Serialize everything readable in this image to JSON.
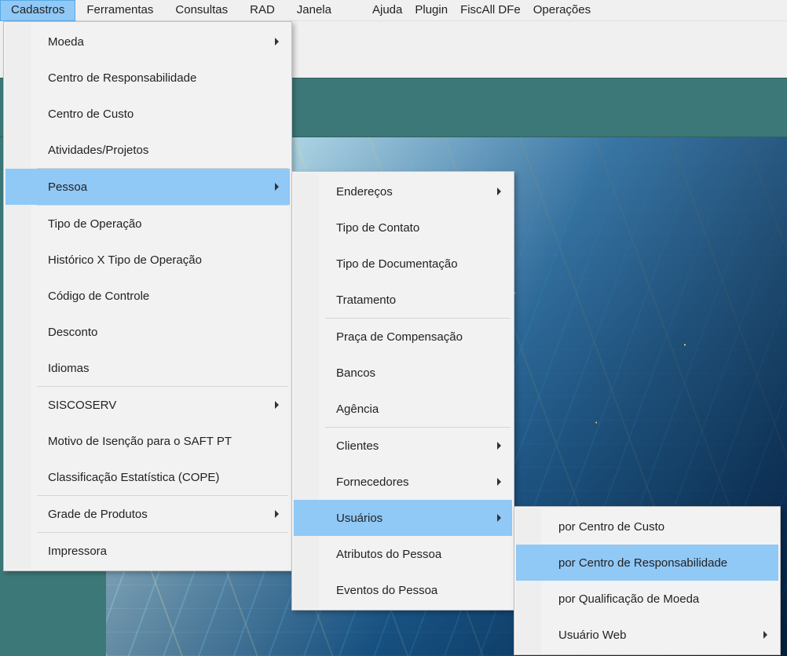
{
  "menubar": {
    "items": [
      {
        "label": "Cadastros",
        "active": true
      },
      {
        "label": "Ferramentas",
        "active": false
      },
      {
        "label": "Consultas",
        "active": false
      },
      {
        "label": "RAD",
        "active": false
      },
      {
        "label": "Janela",
        "active": false
      },
      {
        "label": "Ajuda",
        "active": false
      },
      {
        "label": "Plugin",
        "active": false
      },
      {
        "label": "FiscAll DFe",
        "active": false
      },
      {
        "label": "Operações",
        "active": false
      }
    ]
  },
  "menu_cadastros": {
    "items": [
      {
        "label": "Moeda",
        "submenu": true,
        "sep_after": false,
        "highlight": false
      },
      {
        "label": "Centro de Responsabilidade",
        "submenu": false,
        "sep_after": false,
        "highlight": false
      },
      {
        "label": "Centro de Custo",
        "submenu": false,
        "sep_after": false,
        "highlight": false
      },
      {
        "label": "Atividades/Projetos",
        "submenu": false,
        "sep_after": true,
        "highlight": false
      },
      {
        "label": "Pessoa",
        "submenu": true,
        "sep_after": true,
        "highlight": true
      },
      {
        "label": "Tipo de Operação",
        "submenu": false,
        "sep_after": false,
        "highlight": false
      },
      {
        "label": "Histórico  X Tipo de Operação",
        "submenu": false,
        "sep_after": false,
        "highlight": false
      },
      {
        "label": "Código de Controle",
        "submenu": false,
        "sep_after": false,
        "highlight": false
      },
      {
        "label": "Desconto",
        "submenu": false,
        "sep_after": false,
        "highlight": false
      },
      {
        "label": "Idiomas",
        "submenu": false,
        "sep_after": true,
        "highlight": false
      },
      {
        "label": "SISCOSERV",
        "submenu": true,
        "sep_after": false,
        "highlight": false
      },
      {
        "label": "Motivo de Isenção para o SAFT PT",
        "submenu": false,
        "sep_after": false,
        "highlight": false
      },
      {
        "label": "Classificação Estatística (COPE)",
        "submenu": false,
        "sep_after": true,
        "highlight": false
      },
      {
        "label": "Grade de Produtos",
        "submenu": true,
        "sep_after": true,
        "highlight": false
      },
      {
        "label": "Impressora",
        "submenu": false,
        "sep_after": false,
        "highlight": false
      }
    ]
  },
  "menu_pessoa": {
    "items": [
      {
        "label": "Endereços",
        "submenu": true,
        "sep_after": false,
        "highlight": false
      },
      {
        "label": "Tipo de Contato",
        "submenu": false,
        "sep_after": false,
        "highlight": false
      },
      {
        "label": "Tipo de Documentação",
        "submenu": false,
        "sep_after": false,
        "highlight": false
      },
      {
        "label": "Tratamento",
        "submenu": false,
        "sep_after": true,
        "highlight": false
      },
      {
        "label": "Praça de Compensação",
        "submenu": false,
        "sep_after": false,
        "highlight": false
      },
      {
        "label": "Bancos",
        "submenu": false,
        "sep_after": false,
        "highlight": false
      },
      {
        "label": "Agência",
        "submenu": false,
        "sep_after": true,
        "highlight": false
      },
      {
        "label": "Clientes",
        "submenu": true,
        "sep_after": false,
        "highlight": false
      },
      {
        "label": "Fornecedores",
        "submenu": true,
        "sep_after": false,
        "highlight": false
      },
      {
        "label": "Usuários",
        "submenu": true,
        "sep_after": false,
        "highlight": true
      },
      {
        "label": "Atributos do Pessoa",
        "submenu": false,
        "sep_after": false,
        "highlight": false
      },
      {
        "label": "Eventos do Pessoa",
        "submenu": false,
        "sep_after": false,
        "highlight": false
      }
    ]
  },
  "menu_usuarios": {
    "items": [
      {
        "label": "por Centro de Custo",
        "submenu": false,
        "sep_after": false,
        "highlight": false
      },
      {
        "label": "por Centro de Responsabilidade",
        "submenu": false,
        "sep_after": false,
        "highlight": true
      },
      {
        "label": "por Qualificação de Moeda",
        "submenu": false,
        "sep_after": false,
        "highlight": false
      },
      {
        "label": "Usuário Web",
        "submenu": true,
        "sep_after": false,
        "highlight": false
      }
    ]
  }
}
